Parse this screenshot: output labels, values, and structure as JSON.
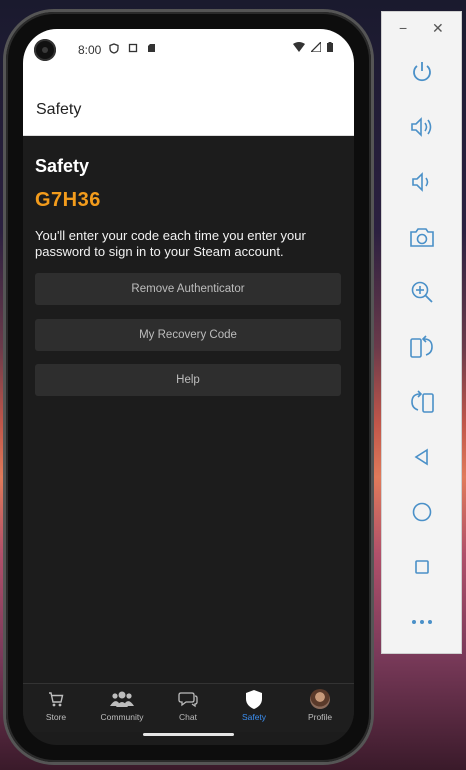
{
  "statusbar": {
    "time": "8:00"
  },
  "appbar": {
    "title": "Safety"
  },
  "main": {
    "heading": "Safety",
    "code": "G7H36",
    "description": "You'll enter your code each time you enter your password to sign in to your Steam account.",
    "buttons": {
      "remove": "Remove Authenticator",
      "recovery": "My Recovery Code",
      "help": "Help"
    }
  },
  "nav": {
    "store": "Store",
    "community": "Community",
    "chat": "Chat",
    "safety": "Safety",
    "profile": "Profile"
  },
  "colors": {
    "accent": "#f39c1c",
    "active": "#3b8ef0"
  },
  "toolbar": {
    "icons": [
      "power-icon",
      "volume-up-icon",
      "volume-down-icon",
      "camera-icon",
      "zoom-icon",
      "rotate-left-icon",
      "rotate-right-icon",
      "back-icon",
      "home-icon",
      "overview-icon",
      "more-icon"
    ]
  }
}
